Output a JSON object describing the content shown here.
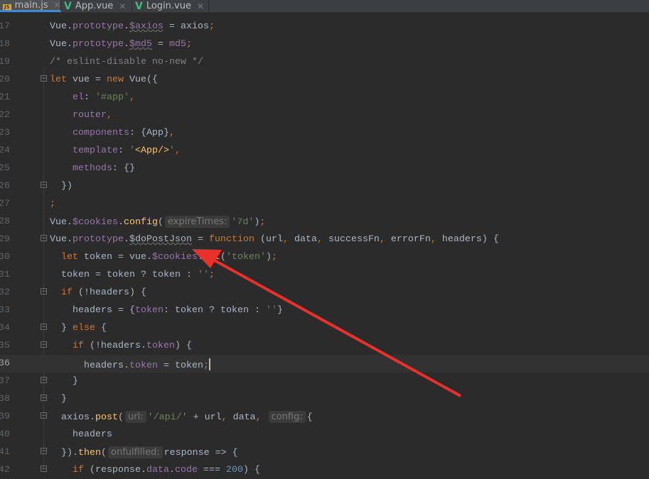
{
  "tabs": [
    {
      "label": "main.js",
      "icon": "js-file-icon",
      "active": true
    },
    {
      "label": "App.vue",
      "icon": "vue-file-icon",
      "active": false
    },
    {
      "label": "Login.vue",
      "icon": "vue-file-icon",
      "active": false
    }
  ],
  "icon_badge_js": "JS",
  "current_line": 36,
  "colors": {
    "background": "#2b2b2b",
    "keyword": "#cc7832",
    "property": "#9876aa",
    "string": "#6a8759",
    "comment": "#808080",
    "function": "#ffc66d",
    "number": "#6897bb",
    "annotation_arrow": "#e8312a"
  },
  "lines": [
    {
      "n": "17",
      "t": [
        [
          "d",
          "Vue."
        ],
        [
          "p",
          "prototype"
        ],
        [
          "d",
          "."
        ],
        [
          "p u",
          "$axios"
        ],
        [
          "d",
          " = axios"
        ],
        [
          "k",
          ";"
        ]
      ]
    },
    {
      "n": "18",
      "t": [
        [
          "d",
          "Vue."
        ],
        [
          "p",
          "prototype"
        ],
        [
          "d",
          "."
        ],
        [
          "p u",
          "$md5"
        ],
        [
          "d",
          " = "
        ],
        [
          "p",
          "md5"
        ],
        [
          "k",
          ";"
        ]
      ]
    },
    {
      "n": "19",
      "t": [
        [
          "c",
          "/* eslint-disable no-new */"
        ]
      ]
    },
    {
      "n": "20",
      "fold": true,
      "t": [
        [
          "k",
          "let "
        ],
        [
          "d",
          "vue = "
        ],
        [
          "k",
          "new "
        ],
        [
          "d",
          "Vue({"
        ]
      ]
    },
    {
      "n": "21",
      "t": [
        [
          "d",
          "    "
        ],
        [
          "p",
          "el"
        ],
        [
          "d",
          ": "
        ],
        [
          "s",
          "'#app'"
        ],
        [
          "k",
          ","
        ]
      ]
    },
    {
      "n": "22",
      "t": [
        [
          "d",
          "    "
        ],
        [
          "p",
          "router"
        ],
        [
          "k",
          ","
        ]
      ]
    },
    {
      "n": "23",
      "t": [
        [
          "d",
          "    "
        ],
        [
          "p",
          "components"
        ],
        [
          "d",
          ": {App}"
        ],
        [
          "k",
          ","
        ]
      ]
    },
    {
      "n": "24",
      "t": [
        [
          "d",
          "    "
        ],
        [
          "p",
          "template"
        ],
        [
          "d",
          ": "
        ],
        [
          "s",
          "'"
        ],
        [
          "f",
          "<App/>"
        ],
        [
          "s",
          "'"
        ],
        [
          "k",
          ","
        ]
      ]
    },
    {
      "n": "25",
      "t": [
        [
          "d",
          "    "
        ],
        [
          "p",
          "methods"
        ],
        [
          "d",
          ": {}"
        ]
      ]
    },
    {
      "n": "26",
      "fold": true,
      "t": [
        [
          "d",
          "  })"
        ]
      ]
    },
    {
      "n": "27",
      "t": [
        [
          "k",
          ";"
        ]
      ]
    },
    {
      "n": "28",
      "t": [
        [
          "d",
          "Vue."
        ],
        [
          "p",
          "$cookies"
        ],
        [
          "d",
          "."
        ],
        [
          "f",
          "config"
        ],
        [
          "d",
          "("
        ],
        [
          "h",
          "expireTimes:"
        ],
        [
          "s",
          "'7d'"
        ],
        [
          "d",
          ")"
        ],
        [
          "k",
          ";"
        ]
      ]
    },
    {
      "n": "29",
      "fold": true,
      "t": [
        [
          "d",
          "Vue."
        ],
        [
          "p",
          "prototype"
        ],
        [
          "d",
          "."
        ],
        [
          "d u",
          "$doPostJson"
        ],
        [
          "d",
          " = "
        ],
        [
          "k",
          "function "
        ],
        [
          "d",
          "(url"
        ],
        [
          "k",
          ","
        ],
        [
          "d",
          " data"
        ],
        [
          "k",
          ","
        ],
        [
          "d",
          " successFn"
        ],
        [
          "k",
          ","
        ],
        [
          "d",
          " errorFn"
        ],
        [
          "k",
          ","
        ],
        [
          "d",
          " headers) {"
        ]
      ]
    },
    {
      "n": "30",
      "t": [
        [
          "d",
          "  "
        ],
        [
          "k",
          "let "
        ],
        [
          "d",
          "token = vue."
        ],
        [
          "p",
          "$cookies"
        ],
        [
          "d",
          "."
        ],
        [
          "f",
          "get"
        ],
        [
          "d",
          "("
        ],
        [
          "s",
          "'token'"
        ],
        [
          "d",
          ")"
        ],
        [
          "k",
          ";"
        ]
      ]
    },
    {
      "n": "31",
      "t": [
        [
          "d",
          "  token = token ? token : "
        ],
        [
          "s",
          "''"
        ],
        [
          "k",
          ";"
        ]
      ]
    },
    {
      "n": "32",
      "fold": true,
      "t": [
        [
          "d",
          "  "
        ],
        [
          "k",
          "if "
        ],
        [
          "d",
          "(!headers) {"
        ]
      ]
    },
    {
      "n": "33",
      "t": [
        [
          "d",
          "    headers = {"
        ],
        [
          "p",
          "token"
        ],
        [
          "d",
          ": token ? token : "
        ],
        [
          "s",
          "''"
        ],
        [
          "d",
          "}"
        ]
      ]
    },
    {
      "n": "34",
      "fold": true,
      "t": [
        [
          "d",
          "  } "
        ],
        [
          "k",
          "else "
        ],
        [
          "d",
          "{"
        ]
      ]
    },
    {
      "n": "35",
      "fold": true,
      "t": [
        [
          "d",
          "    "
        ],
        [
          "k",
          "if "
        ],
        [
          "d",
          "(!headers."
        ],
        [
          "p",
          "token"
        ],
        [
          "d",
          ") {"
        ]
      ]
    },
    {
      "n": "36",
      "t": [
        [
          "d",
          "      headers."
        ],
        [
          "p",
          "token"
        ],
        [
          "d",
          " = token"
        ],
        [
          "k",
          ";"
        ]
      ],
      "caret": true
    },
    {
      "n": "37",
      "fold": true,
      "t": [
        [
          "d",
          "    }"
        ]
      ]
    },
    {
      "n": "38",
      "fold": true,
      "t": [
        [
          "d",
          "  }"
        ]
      ]
    },
    {
      "n": "39",
      "fold": true,
      "t": [
        [
          "d",
          "  axios."
        ],
        [
          "f",
          "post"
        ],
        [
          "d",
          "("
        ],
        [
          "h",
          "url:"
        ],
        [
          "s",
          "'/api/'"
        ],
        [
          "d",
          " + url"
        ],
        [
          "k",
          ","
        ],
        [
          "d",
          " data"
        ],
        [
          "k",
          ","
        ],
        [
          "d",
          " "
        ],
        [
          "h",
          "config:"
        ],
        [
          "d",
          "{"
        ]
      ]
    },
    {
      "n": "40",
      "t": [
        [
          "d",
          "    headers"
        ]
      ]
    },
    {
      "n": "41",
      "fold": true,
      "t": [
        [
          "d",
          "  })."
        ],
        [
          "f",
          "then"
        ],
        [
          "d",
          "("
        ],
        [
          "h",
          "onfulfilled:"
        ],
        [
          "d",
          "response => {"
        ]
      ]
    },
    {
      "n": "42",
      "fold": true,
      "t": [
        [
          "d",
          "    "
        ],
        [
          "k",
          "if "
        ],
        [
          "d",
          "(response."
        ],
        [
          "p",
          "data"
        ],
        [
          "d",
          "."
        ],
        [
          "p",
          "code"
        ],
        [
          "d",
          " === "
        ],
        [
          "n",
          "200"
        ],
        [
          "d",
          ") {"
        ]
      ]
    }
  ]
}
